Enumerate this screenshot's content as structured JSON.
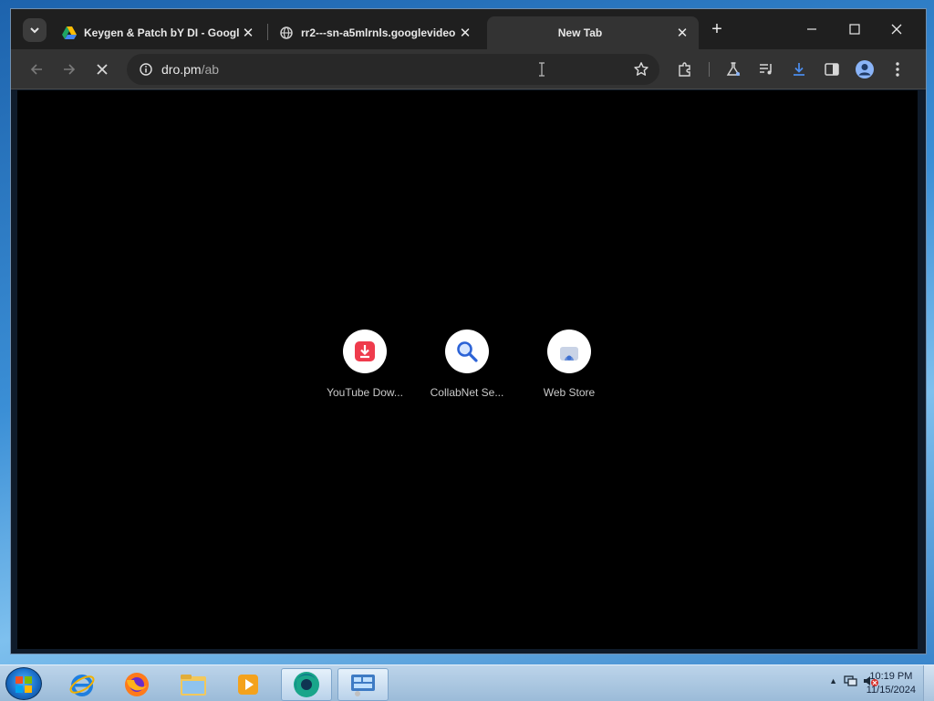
{
  "browser": {
    "tabs": [
      {
        "title": "Keygen & Patch bY DI - Google",
        "favicon": "google-drive-icon",
        "active": false
      },
      {
        "title": "rr2---sn-a5mlrnls.googlevideo",
        "favicon": "globe-icon",
        "active": false
      },
      {
        "title": "New Tab",
        "favicon": "",
        "active": true
      }
    ],
    "new_tab_symbol": "+",
    "omnibox": {
      "url_domain": "dro.pm",
      "url_path": "/ab"
    },
    "toolbar_icons": [
      "back-arrow-icon",
      "forward-arrow-icon",
      "stop-loading-icon",
      "bookmark-star-icon",
      "extensions-icon",
      "labs-flask-icon",
      "media-control-icon",
      "download-icon",
      "side-panel-icon",
      "profile-avatar-icon",
      "more-menu-icon"
    ]
  },
  "new_tab_page": {
    "background": "#000000",
    "shortcuts": [
      {
        "label": "YouTube Dow...",
        "icon": "download-red-icon"
      },
      {
        "label": "CollabNet Se...",
        "icon": "magnifier-icon"
      },
      {
        "label": "Web Store",
        "icon": "web-store-icon"
      }
    ]
  },
  "taskbar": {
    "apps": [
      "internet-explorer-icon",
      "firefox-icon",
      "file-explorer-icon",
      "media-player-icon",
      "browser-active-icon",
      "control-panel-icon"
    ],
    "clock": {
      "time": "10:19 PM",
      "date": "11/15/2024"
    }
  }
}
